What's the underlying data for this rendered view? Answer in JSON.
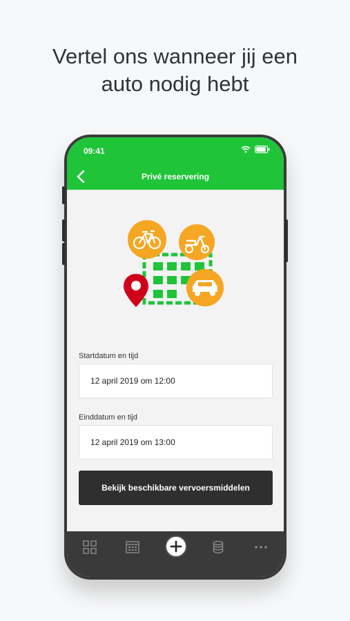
{
  "headline": {
    "line1": "Vertel ons wanneer jij een",
    "line2": "auto nodig hebt"
  },
  "status_bar": {
    "time": "09:41"
  },
  "nav": {
    "title": "Privé reservering"
  },
  "form": {
    "start_label": "Startdatum en tijd",
    "start_value": "12 april 2019 om 12:00",
    "end_label": "Einddatum en tijd",
    "end_value": "12 april 2019 om 13:00",
    "submit_label": "Bekijk beschikbare vervoersmiddelen"
  },
  "colors": {
    "brand_green": "#1fc439",
    "accent_orange": "#f5a623",
    "pin_red": "#d0021b",
    "button_dark": "#2f2f2f"
  },
  "tabbar": {
    "items": [
      "grid-icon",
      "calendar-icon",
      "add-icon",
      "database-icon",
      "more-icon"
    ]
  }
}
